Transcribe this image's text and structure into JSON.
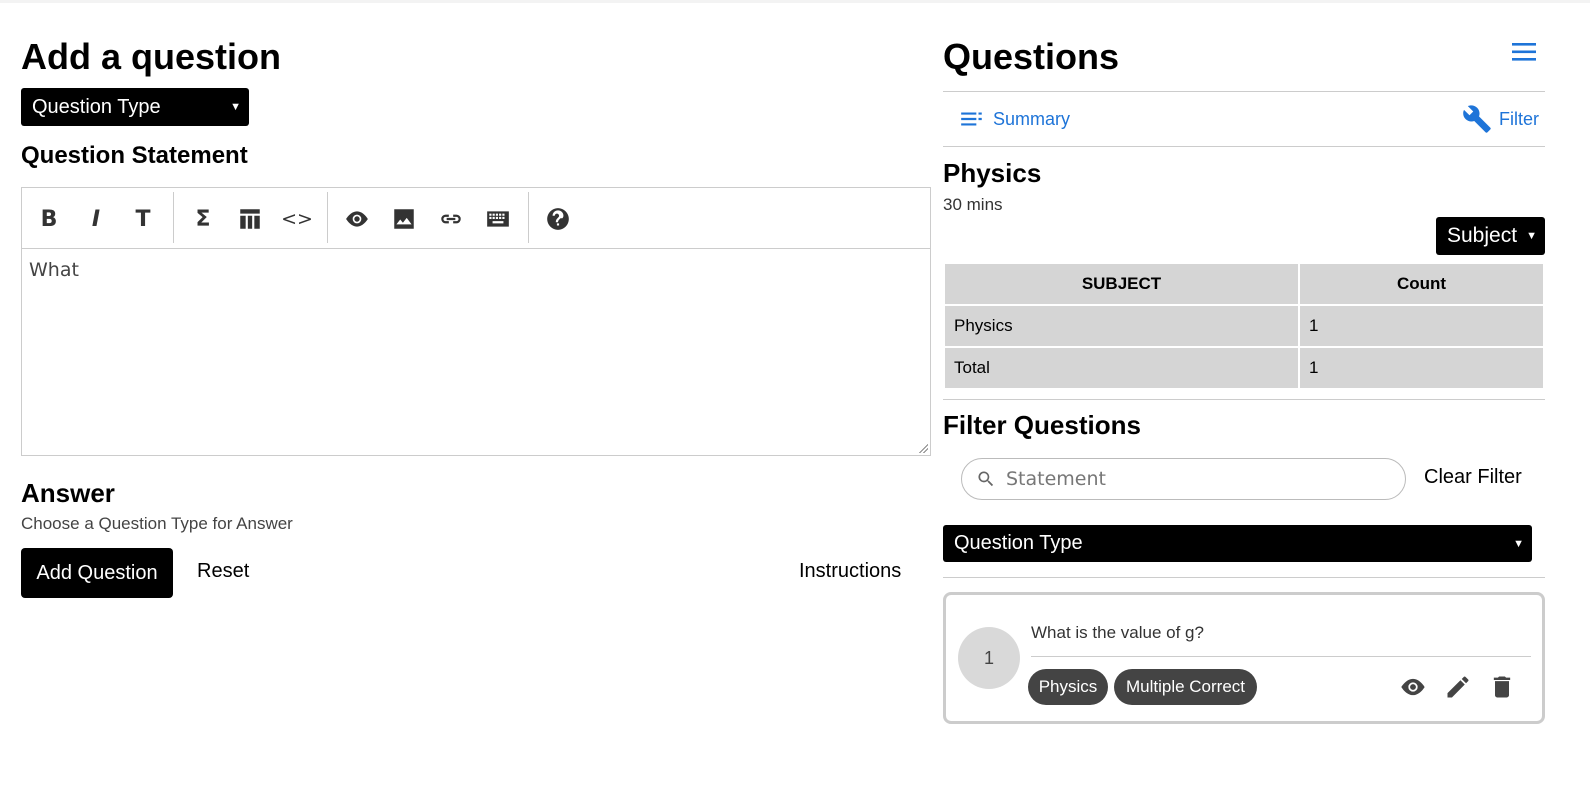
{
  "left": {
    "title": "Add a question",
    "question_type_select": "Question Type",
    "statement_heading": "Question Statement",
    "editor": {
      "toolbar": {
        "bold": "B",
        "italic": "I",
        "heading": "T",
        "math": "Σ",
        "code": "<>"
      },
      "content": "What"
    },
    "answer_heading": "Answer",
    "answer_hint": "Choose a Question Type for Answer",
    "add_button": "Add Question",
    "reset_button": "Reset",
    "instructions_button": "Instructions"
  },
  "right": {
    "title": "Questions",
    "summary_link": "Summary",
    "filter_link": "Filter",
    "subject_heading": "Physics",
    "duration": "30 mins",
    "subject_select": "Subject",
    "table": {
      "headers": [
        "SUBJECT",
        "Count"
      ],
      "rows": [
        [
          "Physics",
          "1"
        ],
        [
          "Total",
          "1"
        ]
      ]
    },
    "filter_heading": "Filter Questions",
    "search_placeholder": "Statement",
    "clear_filter": "Clear Filter",
    "question_type_select": "Question Type",
    "questions": [
      {
        "number": "1",
        "text": "What is the value of g?",
        "tags": [
          "Physics",
          "Multiple Correct"
        ]
      }
    ]
  },
  "colors": {
    "link": "#1e74d8",
    "select_bg": "#000000",
    "table_cell": "#d5d5d5",
    "tag_bg": "#444444"
  },
  "icons": [
    "menu-icon",
    "list-icon",
    "wrench-icon",
    "search-icon",
    "eye-icon",
    "pencil-icon",
    "trash-icon",
    "image-icon",
    "link-icon",
    "keyboard-icon",
    "help-icon",
    "table-icon"
  ]
}
